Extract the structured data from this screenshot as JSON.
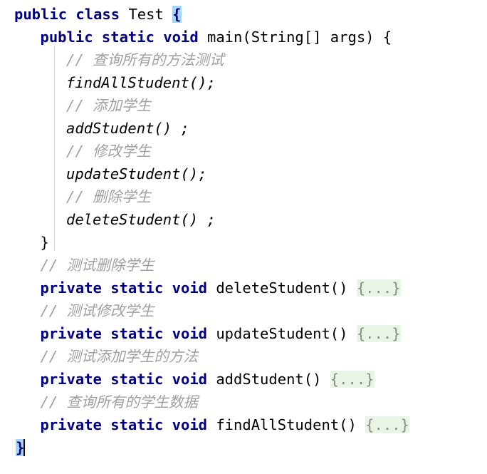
{
  "editor": {
    "language": "Java",
    "file_class": "Test",
    "theme": "light",
    "colors": {
      "background": "#ffffff",
      "keyword": "#000080",
      "comment": "#a0a0a0",
      "identifier": "#000000",
      "folded_placeholder_text": "#8a8a8a",
      "folded_placeholder_bg": "#e9f5e4",
      "brace_match_bg": "#a8d4f7",
      "caret_row_bg": "#fdf8e3",
      "indent_guide": "#d8d8d8"
    },
    "folded_placeholder": "{...}"
  },
  "code": {
    "lines": [
      {
        "indent": 0,
        "tokens": [
          {
            "type": "kw",
            "text": "public class "
          },
          {
            "type": "plain",
            "text": "Test "
          },
          {
            "type": "brace-match",
            "text": "{"
          }
        ]
      },
      {
        "indent": 1,
        "tokens": [
          {
            "type": "kw",
            "text": "public static void "
          },
          {
            "type": "plain",
            "text": "main(String[] args) {"
          }
        ]
      },
      {
        "indent": 2,
        "tokens": [
          {
            "type": "cmt",
            "text": "// 查询所有的方法测试"
          }
        ]
      },
      {
        "indent": 2,
        "tokens": [
          {
            "type": "mth",
            "text": "findAllStudent();"
          }
        ]
      },
      {
        "indent": 2,
        "tokens": [
          {
            "type": "cmt",
            "text": "// 添加学生"
          }
        ]
      },
      {
        "indent": 2,
        "tokens": [
          {
            "type": "mth",
            "text": "addStudent() ;"
          }
        ]
      },
      {
        "indent": 2,
        "tokens": [
          {
            "type": "cmt",
            "text": "// 修改学生"
          }
        ]
      },
      {
        "indent": 2,
        "tokens": [
          {
            "type": "mth",
            "text": "updateStudent();"
          }
        ]
      },
      {
        "indent": 2,
        "tokens": [
          {
            "type": "cmt",
            "text": "// 删除学生"
          }
        ]
      },
      {
        "indent": 2,
        "tokens": [
          {
            "type": "mth",
            "text": "deleteStudent() ;"
          }
        ]
      },
      {
        "indent": 1,
        "tokens": [
          {
            "type": "plain",
            "text": "}"
          }
        ]
      },
      {
        "indent": 1,
        "tokens": [
          {
            "type": "cmt",
            "text": "// 测试删除学生"
          }
        ]
      },
      {
        "indent": 1,
        "tokens": [
          {
            "type": "kw",
            "text": "private static void "
          },
          {
            "type": "plain",
            "text": "deleteStudent() "
          },
          {
            "type": "fold",
            "text": "{...}"
          }
        ]
      },
      {
        "indent": 1,
        "tokens": [
          {
            "type": "cmt",
            "text": "// 测试修改学生"
          }
        ]
      },
      {
        "indent": 1,
        "tokens": [
          {
            "type": "kw",
            "text": "private static void "
          },
          {
            "type": "plain",
            "text": "updateStudent() "
          },
          {
            "type": "fold",
            "text": "{...}"
          }
        ]
      },
      {
        "indent": 1,
        "tokens": [
          {
            "type": "cmt",
            "text": "// 测试添加学生的方法"
          }
        ]
      },
      {
        "indent": 1,
        "tokens": [
          {
            "type": "kw",
            "text": "private static void "
          },
          {
            "type": "plain",
            "text": "addStudent() "
          },
          {
            "type": "fold",
            "text": "{...}"
          }
        ]
      },
      {
        "indent": 1,
        "tokens": [
          {
            "type": "cmt",
            "text": "// 查询所有的学生数据"
          }
        ]
      },
      {
        "indent": 1,
        "tokens": [
          {
            "type": "kw",
            "text": "private static void "
          },
          {
            "type": "plain",
            "text": "findAllStudent() "
          },
          {
            "type": "fold",
            "text": "{...}"
          }
        ]
      },
      {
        "indent": 0,
        "caret_line": true,
        "tokens": [
          {
            "type": "brace-match",
            "text": "}"
          },
          {
            "type": "caret",
            "text": ""
          }
        ]
      }
    ]
  }
}
